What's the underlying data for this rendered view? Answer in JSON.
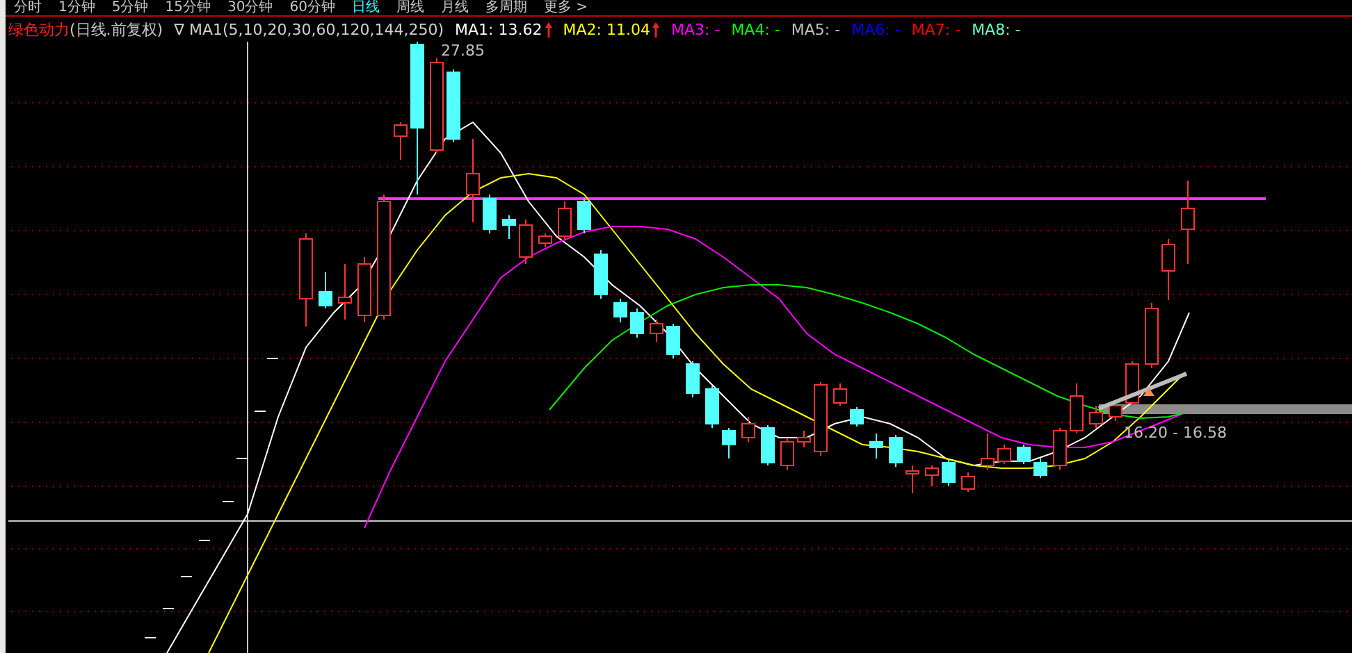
{
  "tabs": [
    {
      "label": "分时",
      "selected": false
    },
    {
      "label": "1分钟",
      "selected": false
    },
    {
      "label": "5分钟",
      "selected": false
    },
    {
      "label": "15分钟",
      "selected": false
    },
    {
      "label": "30分钟",
      "selected": false
    },
    {
      "label": "60分钟",
      "selected": false
    },
    {
      "label": "日线",
      "selected": true
    },
    {
      "label": "周线",
      "selected": false
    },
    {
      "label": "月线",
      "selected": false
    },
    {
      "label": "多周期",
      "selected": false
    },
    {
      "label": "更多 >",
      "selected": false
    }
  ],
  "indicator": {
    "name": "绿色动力",
    "mode": "(日线.前复权)",
    "formula": "∇ MA1(5,10,20,30,60,120,144,250)"
  },
  "ma_values": [
    {
      "label": "MA1:",
      "value": "13.62",
      "color": "#ffffff",
      "rising": true
    },
    {
      "label": "MA2:",
      "value": "11.04",
      "color": "#ffff00",
      "rising": true
    },
    {
      "label": "MA3:",
      "value": "-",
      "color": "#ff00ff",
      "rising": false
    },
    {
      "label": "MA4:",
      "value": "-",
      "color": "#00ff00",
      "rising": false
    },
    {
      "label": "MA5:",
      "value": "-",
      "color": "#c0c0c0",
      "rising": false
    },
    {
      "label": "MA6:",
      "value": "-",
      "color": "#0000ff",
      "rising": false
    },
    {
      "label": "MA7:",
      "value": "-",
      "color": "#ff0000",
      "rising": false
    },
    {
      "label": "MA8:",
      "value": "-",
      "color": "#66ffbb",
      "rising": false
    }
  ],
  "chart": {
    "high_label": "27.85",
    "range_label": "16.20 - 16.58"
  }
}
